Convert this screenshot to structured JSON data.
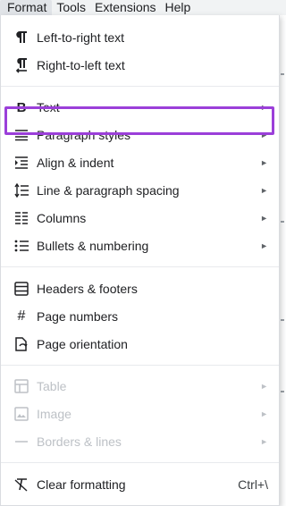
{
  "menubar": {
    "items": [
      {
        "label": "Format"
      },
      {
        "label": "Tools"
      },
      {
        "label": "Extensions"
      },
      {
        "label": "Help"
      }
    ]
  },
  "menu": {
    "items": [
      {
        "label": "Left-to-right text",
        "icon": "pilcrow-ltr-icon"
      },
      {
        "label": "Right-to-left text",
        "icon": "pilcrow-rtl-icon"
      },
      {
        "label": "Text",
        "icon": "bold-icon",
        "submenu": "►"
      },
      {
        "label": "Paragraph styles",
        "icon": "paragraph-lines-icon",
        "submenu": "►"
      },
      {
        "label": "Align & indent",
        "icon": "indent-icon",
        "submenu": "►"
      },
      {
        "label": "Line & paragraph spacing",
        "icon": "line-spacing-icon",
        "submenu": "►"
      },
      {
        "label": "Columns",
        "icon": "columns-icon",
        "submenu": "►"
      },
      {
        "label": "Bullets & numbering",
        "icon": "bulleted-list-icon",
        "submenu": "►"
      },
      {
        "label": "Headers & footers",
        "icon": "header-footer-icon"
      },
      {
        "label": "Page numbers",
        "icon": "hash-icon"
      },
      {
        "label": "Page orientation",
        "icon": "page-orientation-icon"
      },
      {
        "label": "Table",
        "icon": "table-icon",
        "submenu": "►",
        "disabled": true
      },
      {
        "label": "Image",
        "icon": "image-icon",
        "submenu": "►",
        "disabled": true
      },
      {
        "label": "Borders & lines",
        "icon": "horizontal-line-icon",
        "submenu": "►",
        "disabled": true
      },
      {
        "label": "Clear formatting",
        "icon": "clear-formatting-icon",
        "shortcut": "Ctrl+\\"
      }
    ]
  },
  "colors": {
    "highlight_border": "#9b3fd9",
    "disabled_text": "#bdc1c6",
    "menubar_bg": "#f1f3f4"
  }
}
